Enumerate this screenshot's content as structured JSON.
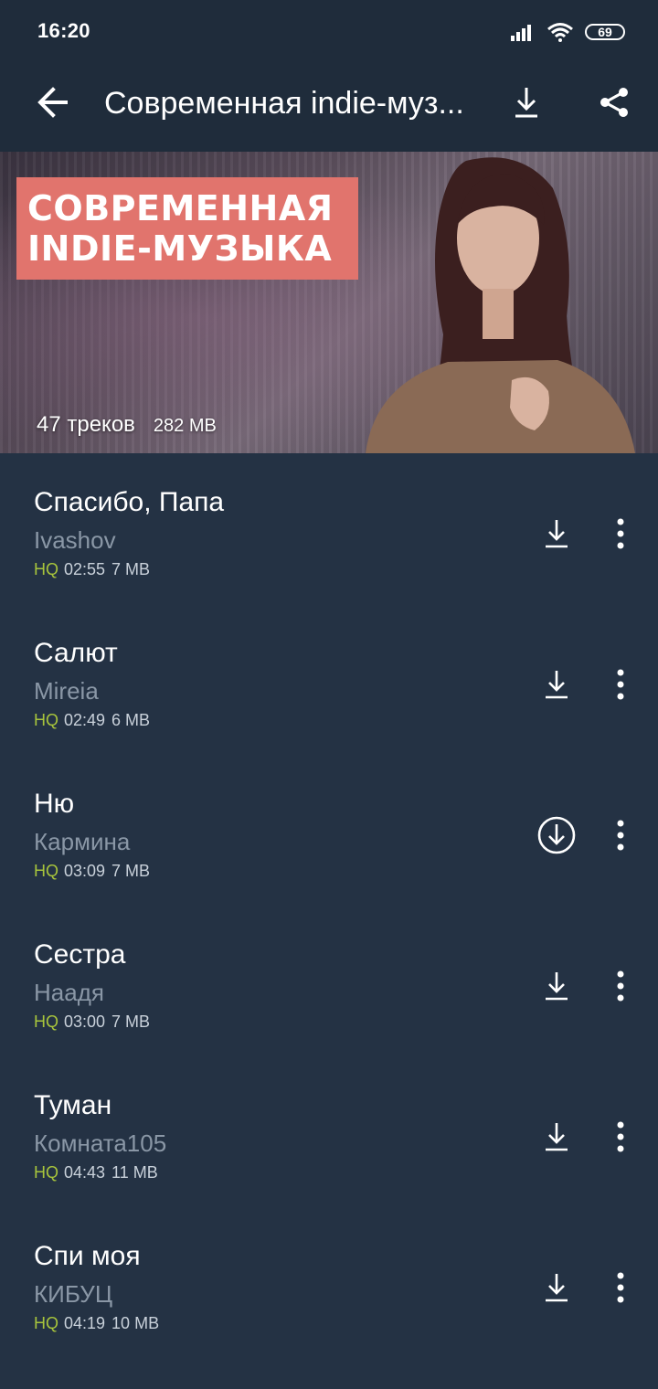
{
  "status_bar": {
    "time": "16:20",
    "battery": "69"
  },
  "app_bar": {
    "title": "Современная indie-муз..."
  },
  "banner": {
    "label_lines": [
      "СОВРЕМЕННАЯ",
      "INDIE-МУЗЫКА"
    ],
    "tracks_count": "47 треков",
    "total_size": "282 MB"
  },
  "tracks": [
    {
      "title": "Спасибо, Папа",
      "artist": "Ivashov",
      "quality": "HQ",
      "duration": "02:55",
      "size": "7 MB",
      "download_icon": "download-icon"
    },
    {
      "title": "Салют",
      "artist": "Mireia",
      "quality": "HQ",
      "duration": "02:49",
      "size": "6 MB",
      "download_icon": "download-icon"
    },
    {
      "title": "Ню",
      "artist": "Кармина",
      "quality": "HQ",
      "duration": "03:09",
      "size": "7 MB",
      "download_icon": "download-circle-icon"
    },
    {
      "title": "Сестра",
      "artist": "Наадя",
      "quality": "HQ",
      "duration": "03:00",
      "size": "7 MB",
      "download_icon": "download-icon"
    },
    {
      "title": "Туман",
      "artist": "Комната105",
      "quality": "HQ",
      "duration": "04:43",
      "size": "11 MB",
      "download_icon": "download-icon"
    },
    {
      "title": "Спи моя",
      "artist": "КИБУЦ",
      "quality": "HQ",
      "duration": "04:19",
      "size": "10 MB",
      "download_icon": "download-icon"
    }
  ],
  "colors": {
    "background": "#243244",
    "app_bar": "#1f2c3b",
    "hq": "#a8c53c",
    "artist": "#8a97a6",
    "banner_label": "#e1746d"
  }
}
